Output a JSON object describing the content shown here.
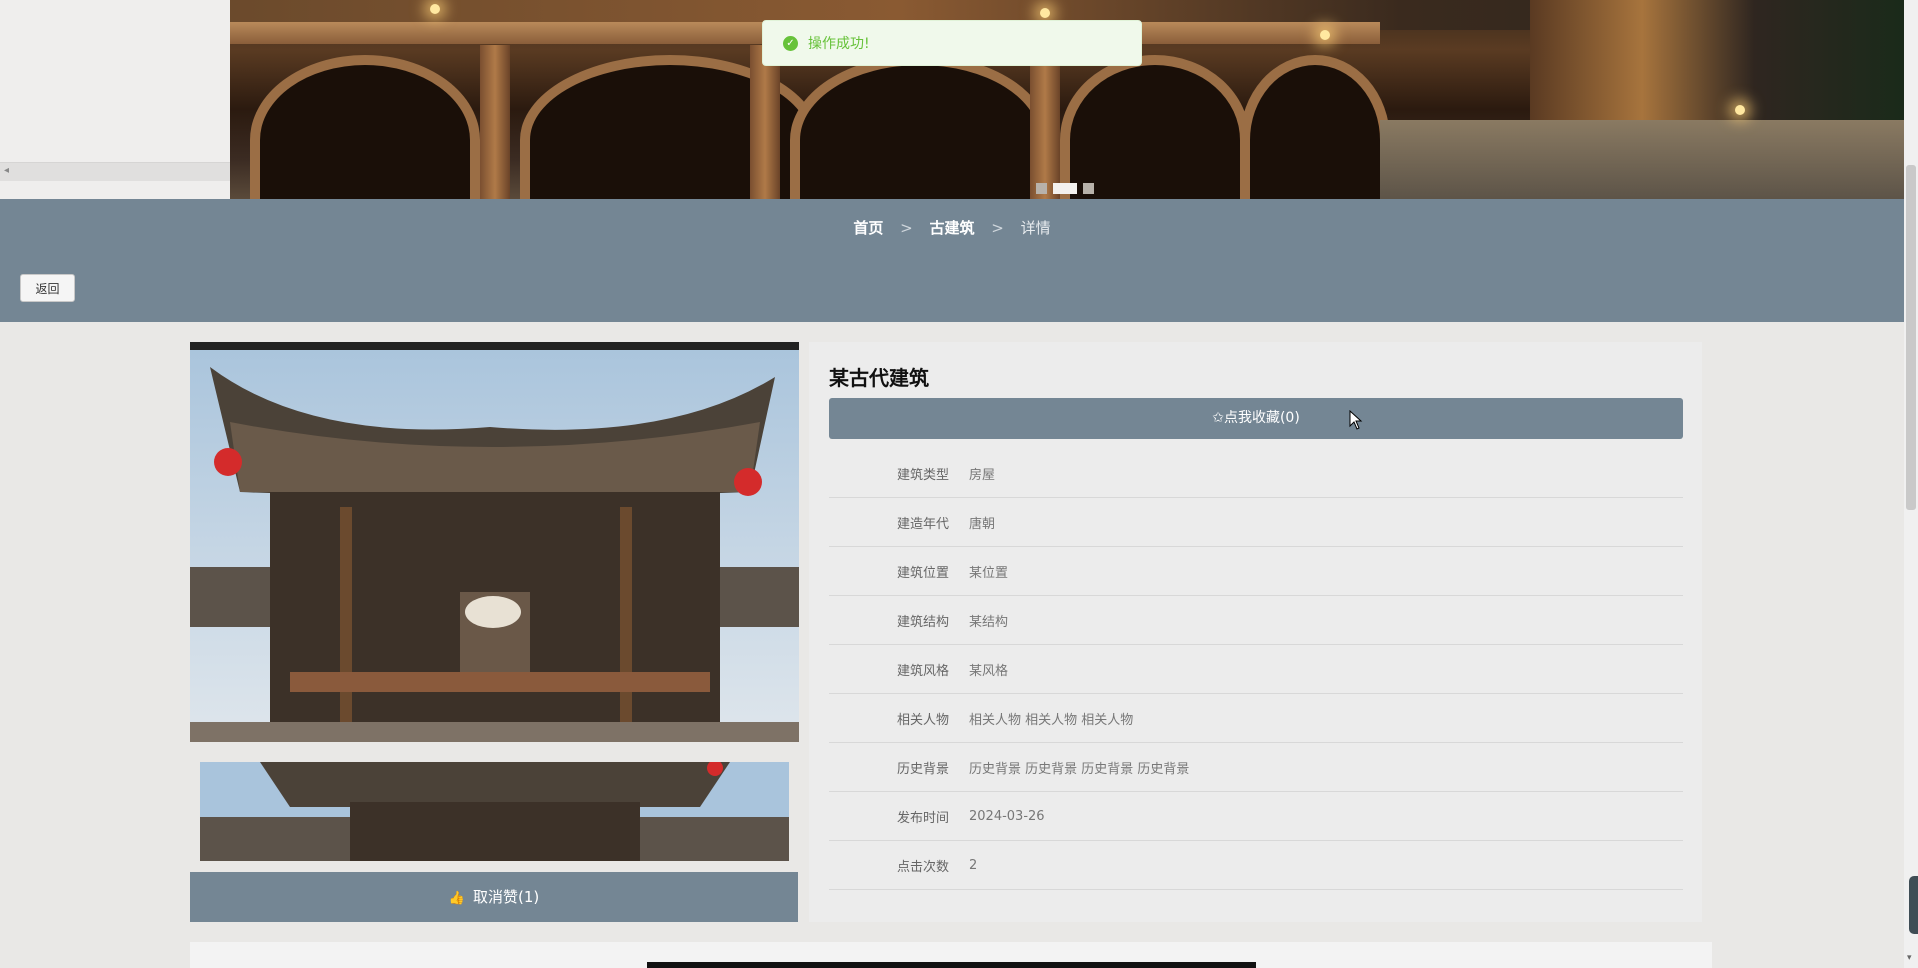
{
  "toast": {
    "icon": "check-circle-icon",
    "message": "操作成功!"
  },
  "banner": {
    "slides": 3,
    "active_slide": 2
  },
  "breadcrumb": {
    "home": "首页",
    "category": "古建筑",
    "current": "详情",
    "separator": ">"
  },
  "back_button": "返回",
  "detail": {
    "title": "某古代建筑",
    "favorite_button": "✩点我收藏(0)",
    "fields": [
      {
        "label": "建筑类型",
        "value": "房屋"
      },
      {
        "label": "建造年代",
        "value": "唐朝"
      },
      {
        "label": "建筑位置",
        "value": "某位置"
      },
      {
        "label": "建筑结构",
        "value": "某结构"
      },
      {
        "label": "建筑风格",
        "value": "某风格"
      },
      {
        "label": "相关人物",
        "value": "相关人物 相关人物 相关人物"
      },
      {
        "label": "历史背景",
        "value": "历史背景 历史背景 历史背景 历史背景"
      },
      {
        "label": "发布时间",
        "value": "2024-03-26"
      },
      {
        "label": "点击次数",
        "value": "2"
      }
    ]
  },
  "like_button": {
    "icon": "thumbs-up-icon",
    "label": "取消赞(1)"
  },
  "colors": {
    "accent": "#748694",
    "toast_green": "#67c23a",
    "page_bg": "#e9e8e6"
  }
}
